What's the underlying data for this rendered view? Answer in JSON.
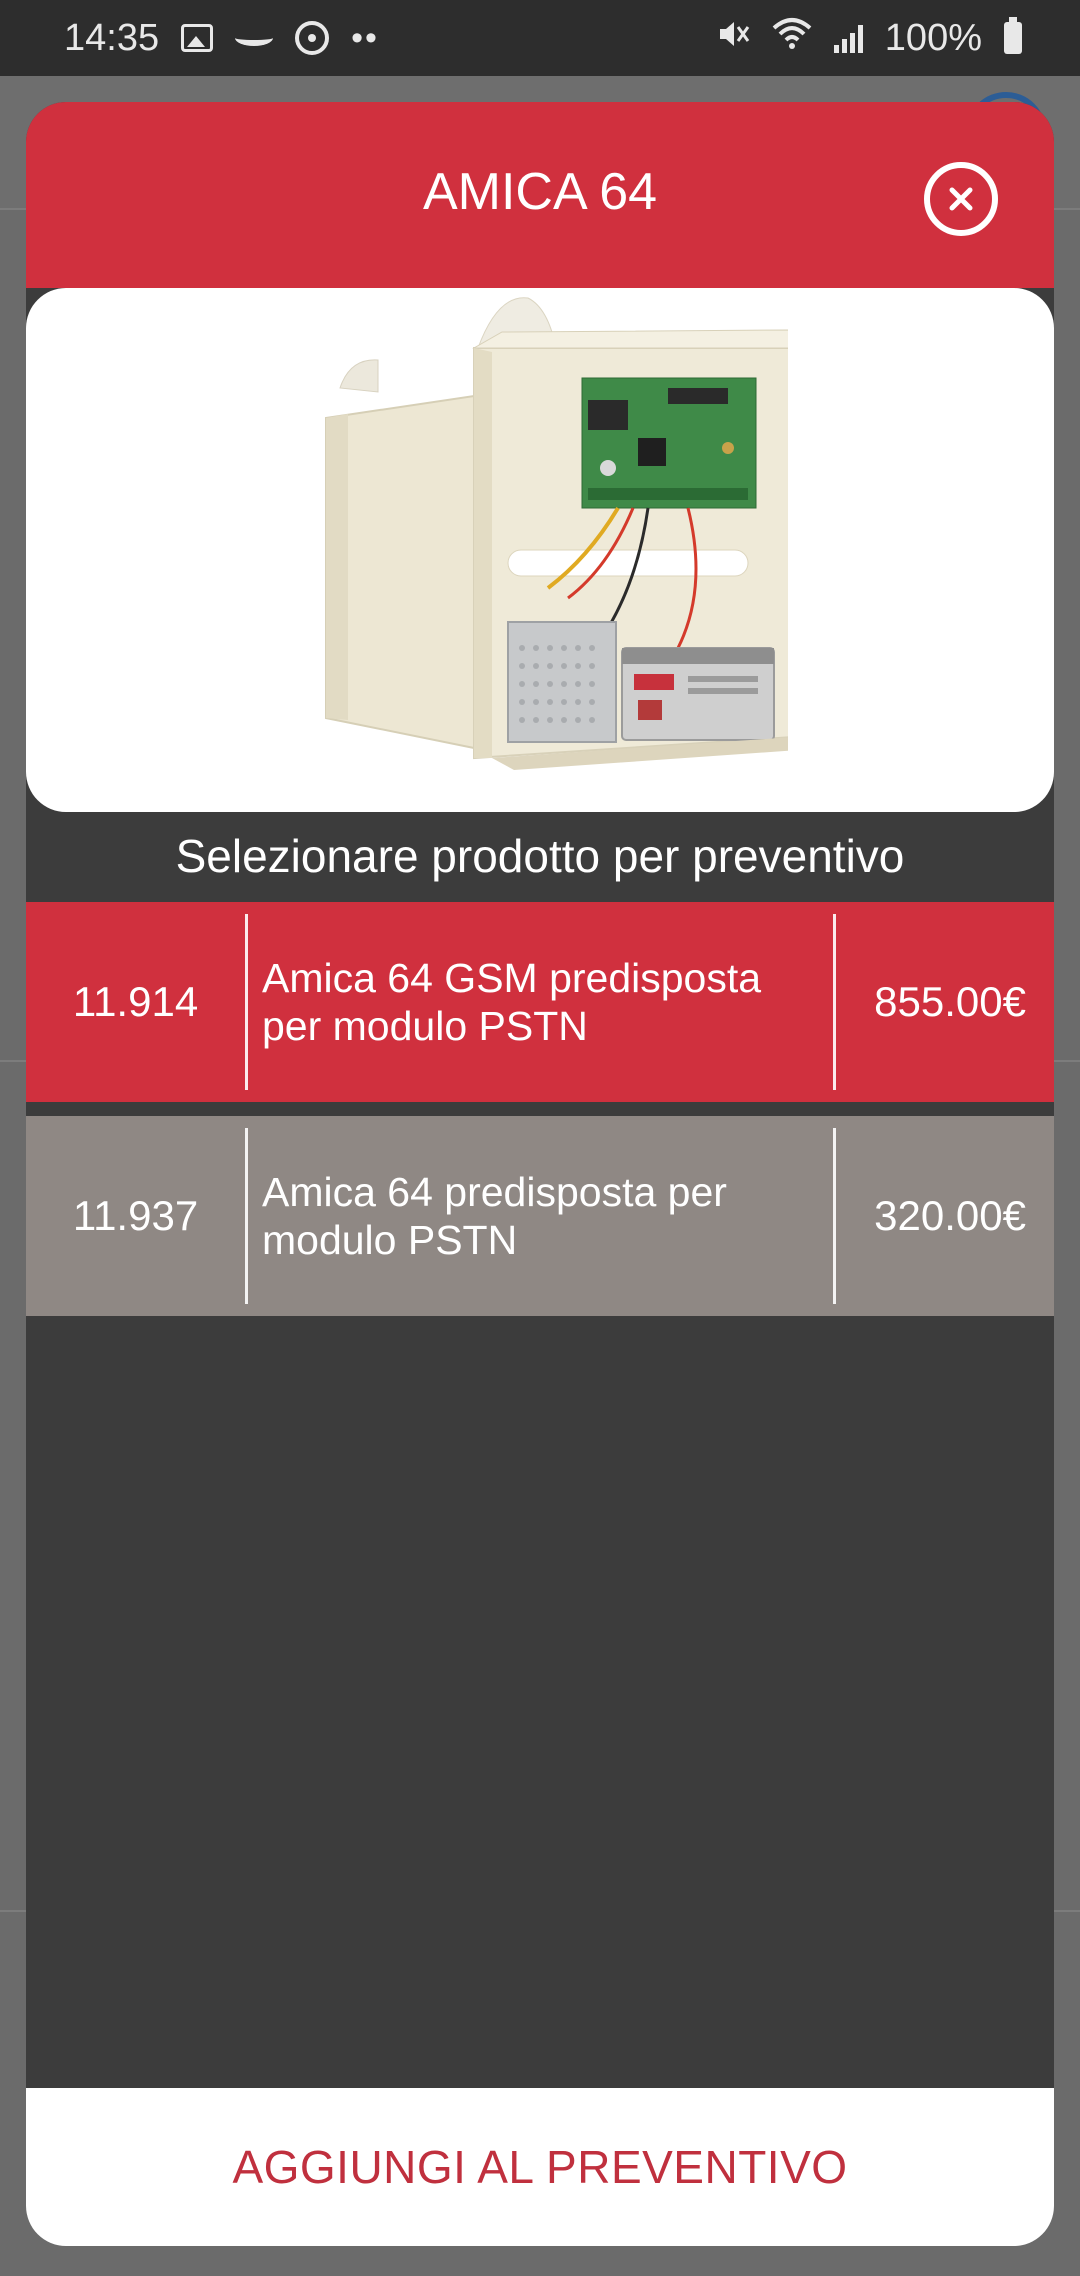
{
  "status_bar": {
    "time": "14:35",
    "battery": "100%",
    "icons": [
      "gallery-icon",
      "bird-icon",
      "circle-dot-icon",
      "dots-icon",
      "mute-icon",
      "wifi-icon",
      "signal-icon",
      "battery-icon"
    ]
  },
  "modal": {
    "title": "AMICA 64",
    "close_icon": "close-circle-icon",
    "image_alt": "alarm control panel product photo",
    "section_heading": "Selezionare prodotto per preventivo",
    "options": [
      {
        "code": "11.914",
        "description": "Amica 64 GSM predisposta per modulo PSTN",
        "price": "855.00€",
        "selected": true
      },
      {
        "code": "11.937",
        "description": "Amica 64 predisposta per modulo PSTN",
        "price": "320.00€",
        "selected": false
      }
    ],
    "footer_button": "AGGIUNGI AL PREVENTIVO"
  },
  "colors": {
    "accent_red": "#d0303e",
    "row_gray": "#8f8884",
    "modal_bg": "#3c3c3c",
    "status_bar_bg": "#2d2d2d"
  }
}
